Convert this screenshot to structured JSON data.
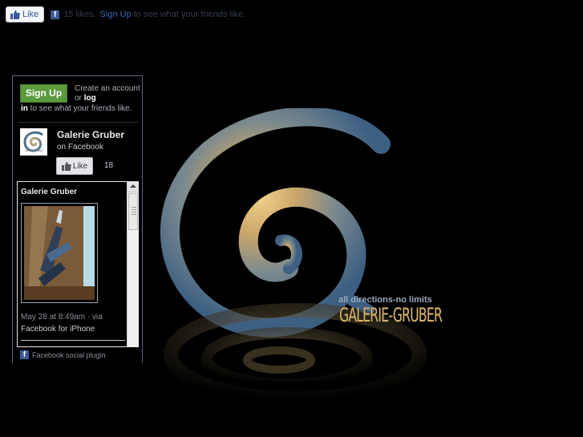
{
  "top": {
    "like_label": "Like",
    "likes_text": "15 likes.",
    "signup_link": "Sign Up",
    "tail_text": "to see what your friends like."
  },
  "panel": {
    "signup_label": "Sign Up",
    "create_pre": "Create an account or",
    "log": "log",
    "in": "in",
    "create_post": "to see what your friends like.",
    "page_name": "Galerie Gruber",
    "page_sub": "on Facebook",
    "like_label": "Like",
    "like_count": "18",
    "post": {
      "author": "Galerie Gruber",
      "time": "May 28 at 8:49am · via",
      "app": "Facebook for iPhone"
    },
    "footer": "Facebook social plugin"
  },
  "logo": {
    "tagline": "all directions-no limits",
    "brand": "GALERIE-GRUBER"
  },
  "colors": {
    "background": "#000000",
    "facebook_blue": "#3b5998",
    "signup_green": "#5c9a3e",
    "logo_gold": "#d4b16c",
    "logo_blue": "#4b6c8c"
  }
}
